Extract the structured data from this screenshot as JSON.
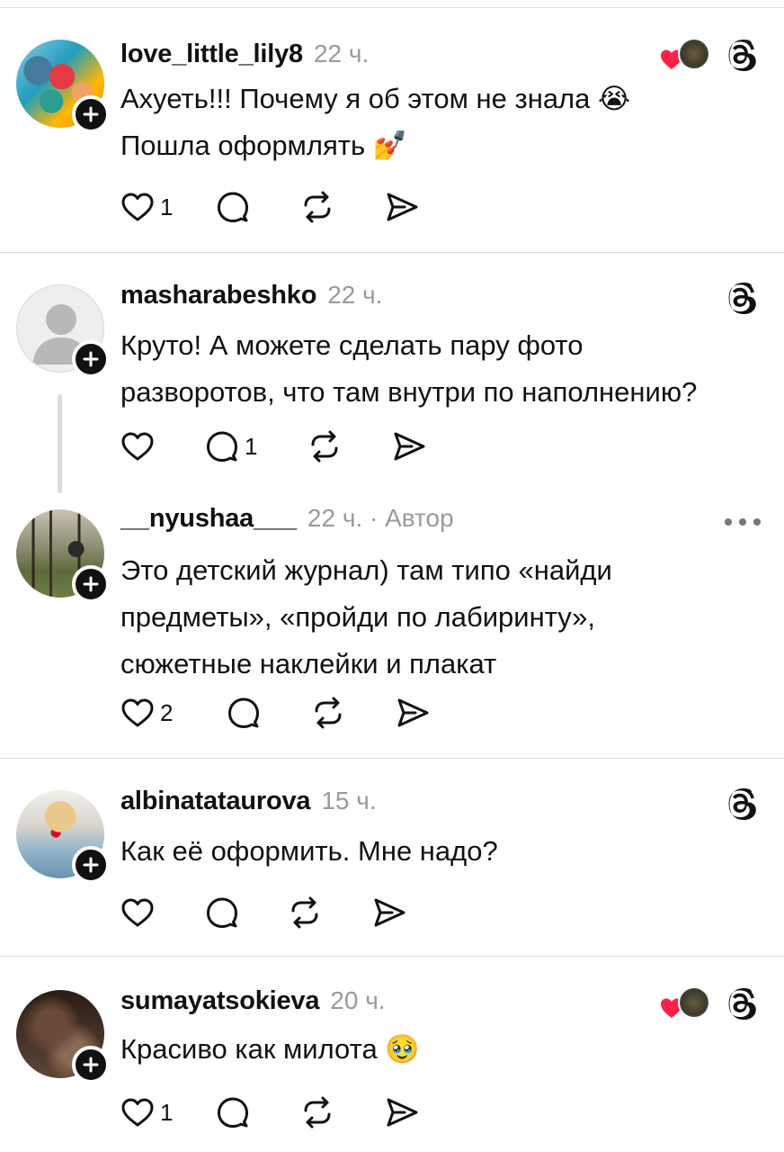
{
  "colors": {
    "text": "#111111",
    "muted": "#9a9a9a",
    "separator": "#dcdcdc",
    "heart": "#ff1f48"
  },
  "icons": {
    "like": "heart-outline-icon",
    "reply": "speech-bubble-icon",
    "repost": "repost-icon",
    "share": "send-icon",
    "threads": "threads-logo-icon",
    "follow": "plus-icon",
    "more": "more-dots-icon"
  },
  "posts": [
    {
      "username": "love_little_lily8",
      "time": "22 ч.",
      "text": [
        "Ахуеть!!! Почему я об этом не знала 😭",
        "Пошла оформлять 💅"
      ],
      "likes": "1",
      "replies": "",
      "liked_by_author": true
    },
    {
      "username": "masharabeshko",
      "time": "22 ч.",
      "text": [
        "Круто! А можете сделать пару фото",
        "разворотов, что там внутри по наполнению?"
      ],
      "likes": "",
      "replies": "1",
      "liked_by_author": false
    },
    {
      "username": "__nyushaa___",
      "time": "22 ч. · Автор",
      "text": [
        "Это детский журнал) там типо «найди",
        "предметы», «пройди по лабиринту»,",
        "сюжетные наклейки и плакат"
      ],
      "likes": "2",
      "replies": "",
      "liked_by_author": false
    },
    {
      "username": "albinatataurova",
      "time": "15 ч.",
      "text": [
        "Как её оформить. Мне надо?"
      ],
      "likes": "",
      "replies": "",
      "liked_by_author": false
    },
    {
      "username": "sumayatsokieva",
      "time": "20 ч.",
      "text": [
        "Красиво как милота 🥹"
      ],
      "likes": "1",
      "replies": "",
      "liked_by_author": true
    }
  ]
}
